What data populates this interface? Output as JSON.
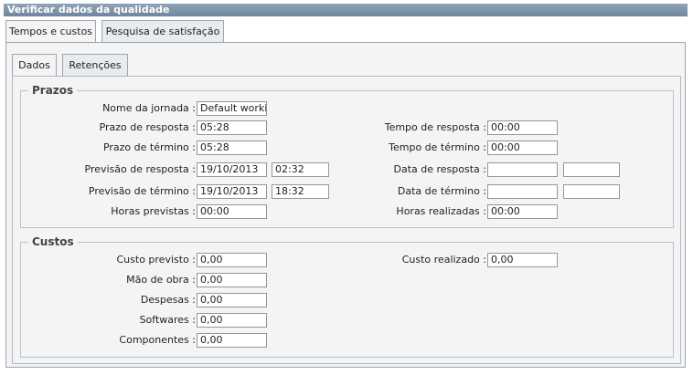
{
  "window": {
    "title": "Verificar dados da qualidade"
  },
  "tabs": [
    "Tempos e custos",
    "Pesquisa de satisfação"
  ],
  "subtabs": [
    "Dados",
    "Retenções"
  ],
  "prazos": {
    "legend": "Prazos",
    "nome_jornada": {
      "label": "Nome da jornada :",
      "value": "Default working"
    },
    "prazo_resposta": {
      "label": "Prazo de resposta :",
      "value": "05:28"
    },
    "prazo_termino": {
      "label": "Prazo de término :",
      "value": "05:28"
    },
    "previsao_resposta": {
      "label": "Previsão de resposta :",
      "date": "19/10/2013",
      "time": "02:32"
    },
    "previsao_termino": {
      "label": "Previsão de término :",
      "date": "19/10/2013",
      "time": "18:32"
    },
    "horas_previstas": {
      "label": "Horas previstas :",
      "value": "00:00"
    },
    "tempo_resposta": {
      "label": "Tempo de resposta :",
      "value": "00:00"
    },
    "tempo_termino": {
      "label": "Tempo de término :",
      "value": "00:00"
    },
    "data_resposta": {
      "label": "Data de resposta :",
      "date": "",
      "time": ""
    },
    "data_termino": {
      "label": "Data de término :",
      "date": "",
      "time": ""
    },
    "horas_realizadas": {
      "label": "Horas realizadas :",
      "value": "00:00"
    }
  },
  "custos": {
    "legend": "Custos",
    "custo_previsto": {
      "label": "Custo previsto :",
      "value": "0,00"
    },
    "mao_de_obra": {
      "label": "Mão de obra :",
      "value": "0,00"
    },
    "despesas": {
      "label": "Despesas :",
      "value": "0,00"
    },
    "softwares": {
      "label": "Softwares :",
      "value": "0,00"
    },
    "componentes": {
      "label": "Componentes :",
      "value": "0,00"
    },
    "custo_realizado": {
      "label": "Custo realizado :",
      "value": "0,00"
    }
  }
}
